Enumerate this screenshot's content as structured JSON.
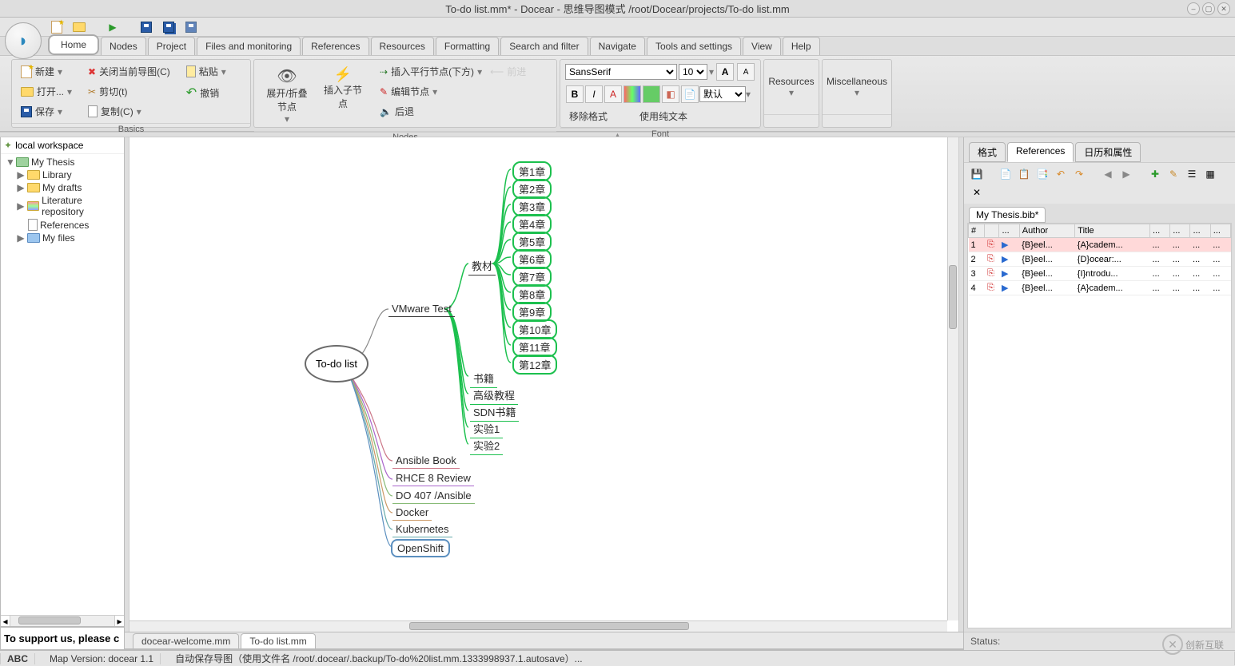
{
  "title": "To-do list.mm* - Docear - 思维导图模式 /root/Docear/projects/To-do list.mm",
  "menu": [
    "Home",
    "Nodes",
    "Project",
    "Files and monitoring",
    "References",
    "Resources",
    "Formatting",
    "Search and filter",
    "Navigate",
    "Tools and settings",
    "View",
    "Help"
  ],
  "ribbon": {
    "basics": {
      "label": "Basics",
      "new": "新建",
      "open": "打开...",
      "save": "保存",
      "close": "关闭当前导图(C)",
      "cut": "剪切(t)",
      "copy": "复制(C)",
      "paste": "粘贴",
      "undo": "撤销"
    },
    "nodes": {
      "label": "Nodes",
      "expand": "展开/折叠节点",
      "insertChild": "插入子节点",
      "insertParallel": "插入平行节点(下方)",
      "editNode": "编辑节点",
      "back": "后退",
      "forward": "前进"
    },
    "font": {
      "label": "Font",
      "family": "SansSerif",
      "size": "10",
      "clearFmt": "移除格式",
      "usePlain": "使用纯文本",
      "defaultStyle": "默认"
    },
    "resources": "Resources",
    "misc": "Miscellaneous"
  },
  "tree": {
    "root": "local workspace",
    "items": [
      {
        "label": "My Thesis",
        "ico": "green",
        "expand": "▼"
      },
      {
        "label": "Library",
        "ico": "yellow",
        "expand": "▶",
        "indent": 1
      },
      {
        "label": "My drafts",
        "ico": "yellow",
        "expand": "▶",
        "indent": 1
      },
      {
        "label": "Literature repository",
        "ico": "multi",
        "expand": "▶",
        "indent": 1
      },
      {
        "label": "References",
        "ico": "doc",
        "expand": "",
        "indent": 1
      },
      {
        "label": "My files",
        "ico": "blue",
        "expand": "▶",
        "indent": 1
      }
    ]
  },
  "support": "To support us, please c",
  "mindmap": {
    "root": "To-do list",
    "vtest": "VMware Test",
    "teach": "教材",
    "chap": [
      "第1章",
      "第2章",
      "第3章",
      "第4章",
      "第5章",
      "第6章",
      "第7章",
      "第8章",
      "第9章",
      "第10章",
      "第11章",
      "第12章"
    ],
    "sub": [
      "书籍",
      "高级教程",
      "SDN书籍",
      "实验1",
      "实验2"
    ],
    "extra": [
      "Ansible Book",
      "RHCE 8 Review",
      "DO 407 /Ansible",
      "Docker",
      "Kubernetes",
      "OpenShift"
    ]
  },
  "docTabs": [
    "docear-welcome.mm",
    "To-do list.mm"
  ],
  "rightTabs": [
    "格式",
    "References",
    "日历和属性"
  ],
  "fileTab": "My Thesis.bib*",
  "refTable": {
    "headers": [
      "#",
      "",
      "...",
      "Author",
      "Title",
      "...",
      "...",
      "...",
      "..."
    ],
    "rows": [
      [
        "1",
        "",
        "",
        "{B}eel...",
        "{A}cadem...",
        "...",
        "...",
        "...",
        "..."
      ],
      [
        "2",
        "",
        "",
        "{B}eel...",
        "{D}ocear:...",
        "...",
        "...",
        "...",
        "..."
      ],
      [
        "3",
        "",
        "",
        "{B}eel...",
        "{I}ntrodu...",
        "...",
        "...",
        "...",
        "..."
      ],
      [
        "4",
        "",
        "",
        "{B}eel...",
        "{A}cadem...",
        "...",
        "...",
        "...",
        "..."
      ]
    ]
  },
  "status": "Status:",
  "bottom": {
    "abc": "ABC",
    "ver": "Map Version: docear 1.1",
    "msg": "自动保存导图（使用文件名 /root/.docear/.backup/To-do%20list.mm.1333998937.1.autosave）..."
  },
  "watermark": "创新互联"
}
